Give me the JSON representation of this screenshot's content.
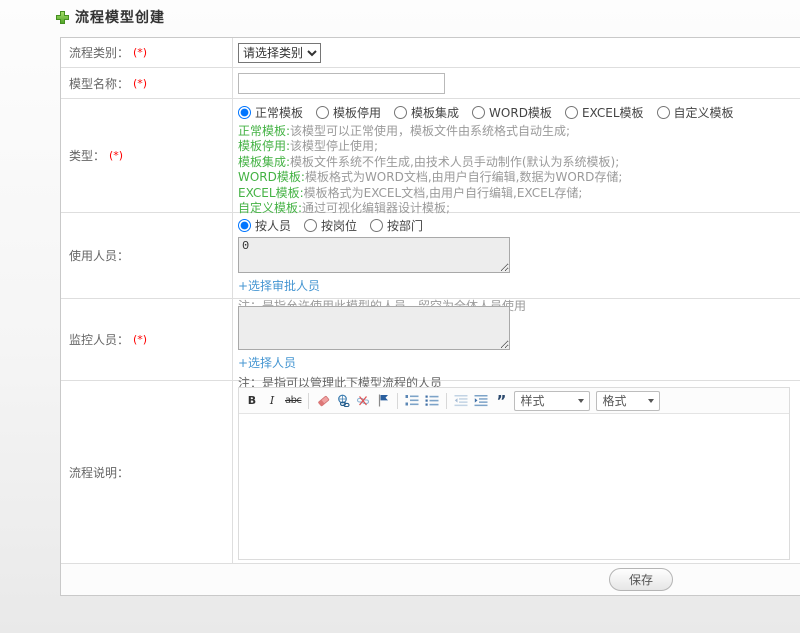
{
  "header": {
    "title": "流程模型创建",
    "icon": "plus-icon"
  },
  "colors": {
    "accent_green": "#44b244",
    "link_blue": "#4596d2",
    "required_red": "#ff0000"
  },
  "form": {
    "category": {
      "label": "流程类别：",
      "required": "(*)",
      "select_value": "请选择类别"
    },
    "model_name": {
      "label": "模型名称：",
      "required": "(*)",
      "input_value": ""
    },
    "type": {
      "label": "类型：",
      "required": "(*)",
      "options": [
        "正常模板",
        "模板停用",
        "模板集成",
        "WORD模板",
        "EXCEL模板",
        "自定义模板"
      ],
      "selected_option": "正常模板",
      "descriptions": [
        {
          "term": "正常模板:",
          "text": "该模型可以正常使用，模板文件由系统格式自动生成;"
        },
        {
          "term": "模板停用:",
          "text": "该模型停止使用;"
        },
        {
          "term": "模板集成:",
          "text": "模板文件系统不作生成,由技术人员手动制作(默认为系统模板);"
        },
        {
          "term": "WORD模板:",
          "text": "模板格式为WORD文档,由用户自行编辑,数据为WORD存储;"
        },
        {
          "term": "EXCEL模板:",
          "text": "模板格式为EXCEL文档,由用户自行编辑,EXCEL存储;"
        },
        {
          "term": "自定义模板:",
          "text": "通过可视化编辑器设计模板;"
        }
      ]
    },
    "users": {
      "label": "使用人员：",
      "options": [
        "按人员",
        "按岗位",
        "按部门"
      ],
      "selected_option": "按人员",
      "textarea_value": "0",
      "link": "+选择审批人员",
      "note": "注：是指允许使用此模型的人员，留空为全体人员使用"
    },
    "monitor": {
      "label": "监控人员：",
      "required": "(*)",
      "textarea_value": "",
      "link": "+选择人员",
      "note": "注：是指可以管理此下模型流程的人员"
    },
    "description": {
      "label": "流程说明：",
      "toolbar": {
        "bold": "B",
        "italic": "I",
        "strike": "abc",
        "quote": "”",
        "styles_combo": "样式",
        "format_combo": "格式",
        "icons": [
          "remove-format-icon",
          "link-icon",
          "unlink-icon",
          "flag-icon",
          "ordered-list-icon",
          "bullet-list-icon",
          "outdent-icon",
          "indent-icon"
        ]
      }
    },
    "save_button": "保存"
  }
}
